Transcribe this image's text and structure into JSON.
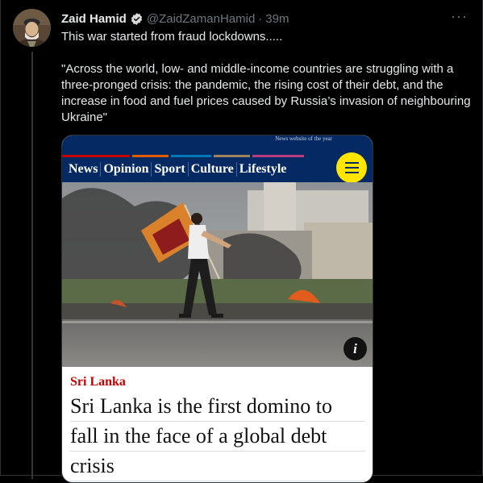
{
  "tweet": {
    "author_name": "Zaid Hamid",
    "handle": "@ZaidZamanHamid",
    "separator": "·",
    "time": "39m",
    "more_label": "···",
    "paragraph_1": "This war started from fraud lockdowns.....",
    "paragraph_2": "\"Across the world, low- and middle-income countries are struggling with a three-pronged crisis: the pandemic, the rising cost of their debt, and the increase in food and fuel prices caused by Russia’s invasion of neighbouring Ukraine\""
  },
  "media": {
    "masthead_award": "News website of the year",
    "nav_items": [
      "News",
      "Opinion",
      "Sport",
      "Culture",
      "Lifestyle"
    ],
    "info_label": "i",
    "kicker": "Sri Lanka",
    "headline_lines": [
      "Sri Lanka is the first domino to",
      "fall in the face of a global debt",
      "crisis"
    ]
  },
  "colors": {
    "background": "#000000",
    "verified_badge": "#d9d9d9",
    "guardian_navy": "#052962",
    "menu_yellow": "#ffe500",
    "kicker_red": "#c70000"
  },
  "icons": [
    "avatar-image",
    "verified-badge-icon",
    "more-options-icon",
    "hamburger-menu-icon",
    "info-icon"
  ]
}
